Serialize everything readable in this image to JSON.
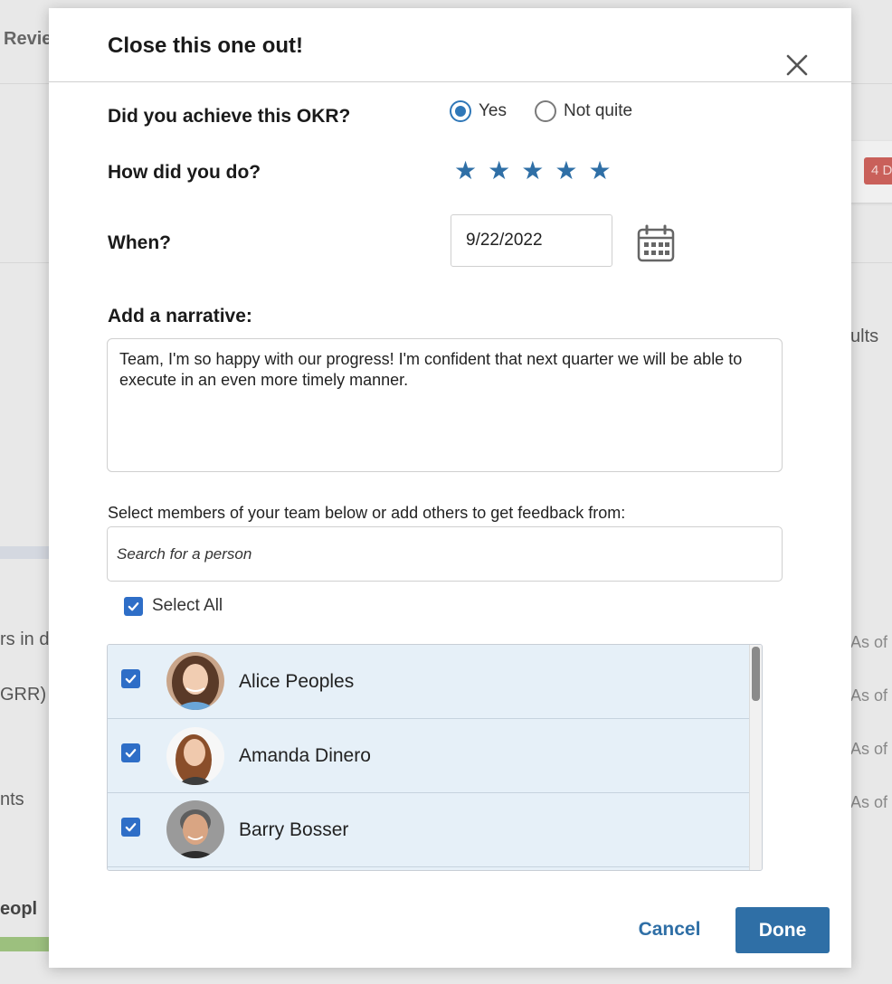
{
  "background": {
    "texts": [
      "Revie",
      "ults",
      "rs in d",
      "GRR)",
      "nts",
      "eopl",
      "As of",
      "As of",
      "As of",
      "As of"
    ],
    "badge": "4 D"
  },
  "modal": {
    "title": "Close this one out!",
    "close_icon": "close-icon",
    "achieve": {
      "label": "Did you achieve this OKR?",
      "options": [
        "Yes",
        "Not quite"
      ],
      "selected": "Yes"
    },
    "rating": {
      "label": "How did you do?",
      "stars": 5,
      "max": 5,
      "color": "#2f6fa6"
    },
    "when": {
      "label": "When?",
      "value": "9/22/2022",
      "icon": "calendar-icon"
    },
    "narrative": {
      "label": "Add a narrative:",
      "value": "Team, I'm so happy with our progress! I'm confident that next quarter we will be able to execute in an even more timely manner."
    },
    "feedback": {
      "prompt": "Select members of your team below or add others to get feedback from:",
      "search_placeholder": "Search for a person",
      "select_all_label": "Select All",
      "select_all_checked": true,
      "people": [
        {
          "name": "Alice Peoples",
          "checked": true
        },
        {
          "name": "Amanda Dinero",
          "checked": true
        },
        {
          "name": "Barry Bosser",
          "checked": true
        }
      ]
    },
    "buttons": {
      "cancel": "Cancel",
      "done": "Done"
    },
    "accent_color": "#2f6fa6",
    "checkbox_color": "#2e6ec7"
  }
}
